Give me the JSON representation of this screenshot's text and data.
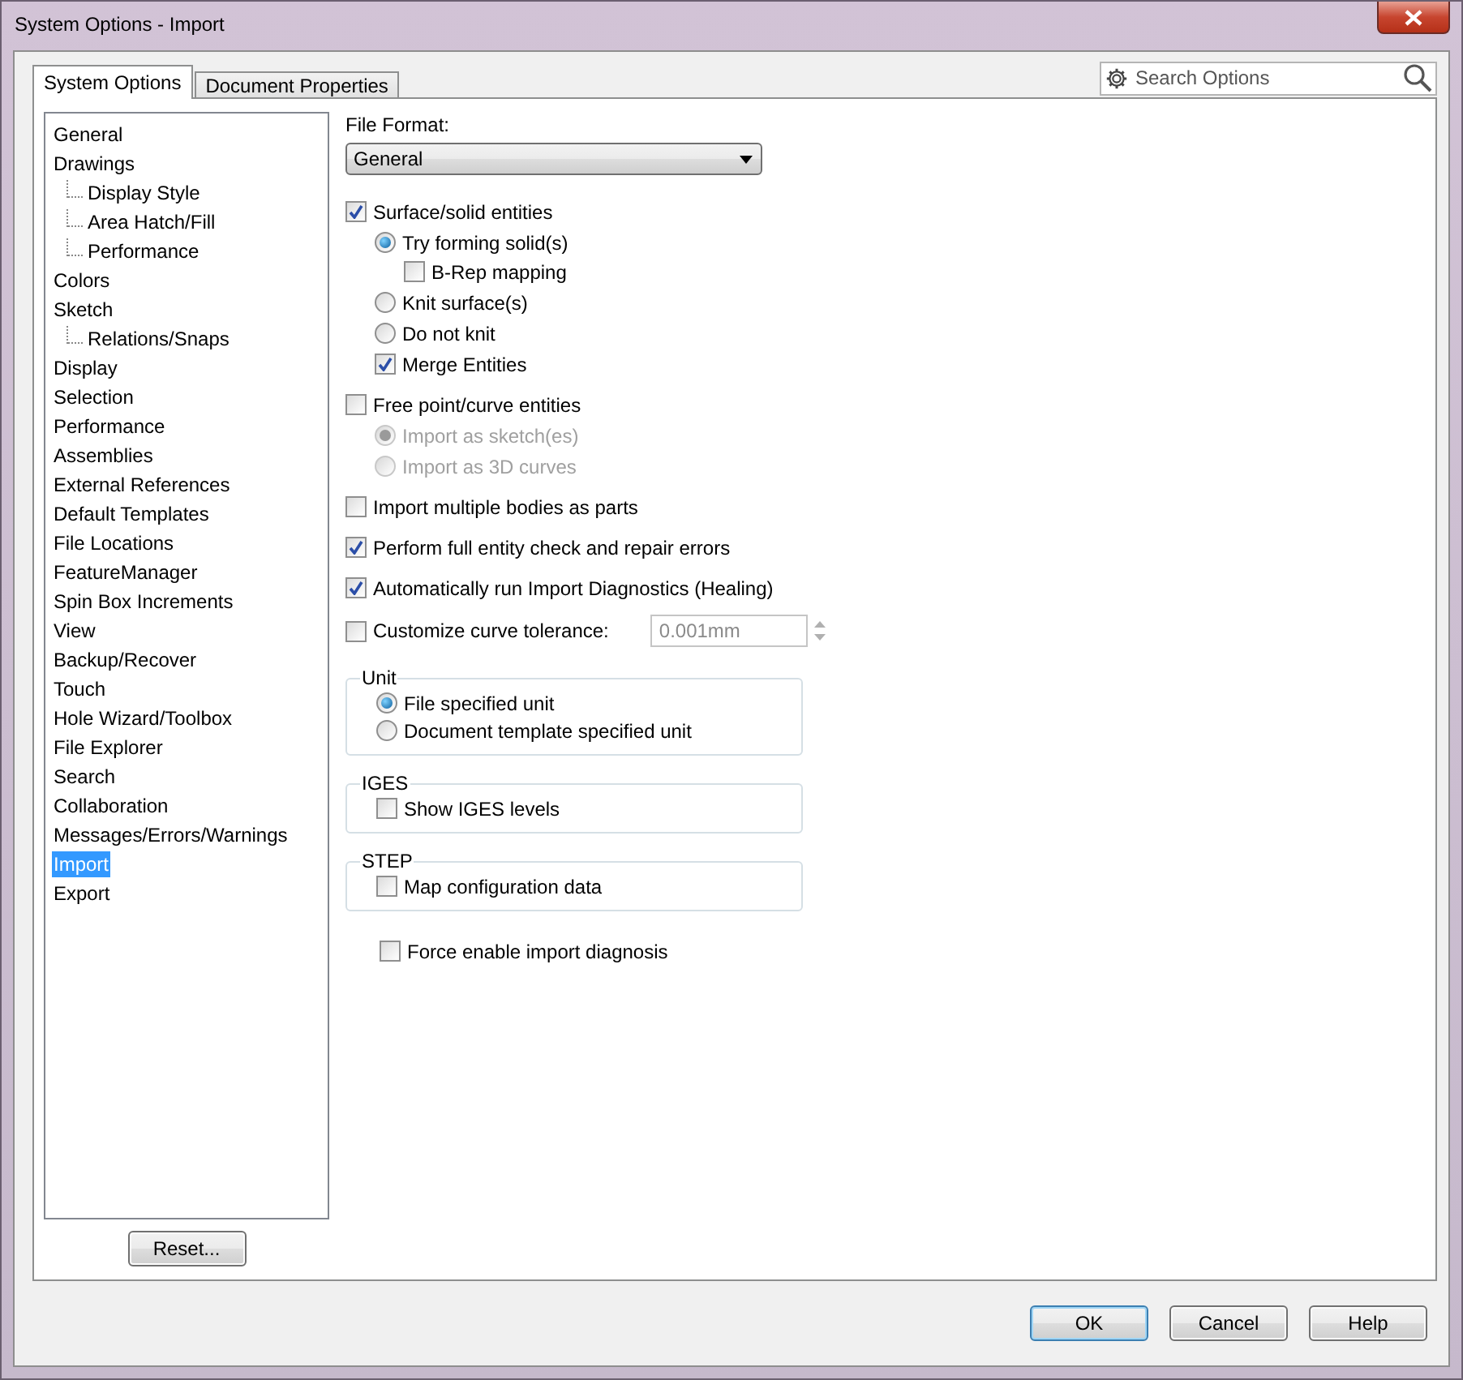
{
  "window": {
    "title": "System Options - Import"
  },
  "tabs": [
    {
      "label": "System Options",
      "selected": true
    },
    {
      "label": "Document Properties",
      "selected": false
    }
  ],
  "search": {
    "placeholder": "Search Options"
  },
  "tree": [
    {
      "label": "General",
      "selected": false
    },
    {
      "label": "Drawings",
      "selected": false,
      "children": [
        {
          "label": "Display Style",
          "selected": false
        },
        {
          "label": "Area Hatch/Fill",
          "selected": false
        },
        {
          "label": "Performance",
          "selected": false
        }
      ]
    },
    {
      "label": "Colors",
      "selected": false
    },
    {
      "label": "Sketch",
      "selected": false,
      "children": [
        {
          "label": "Relations/Snaps",
          "selected": false
        }
      ]
    },
    {
      "label": "Display",
      "selected": false
    },
    {
      "label": "Selection",
      "selected": false
    },
    {
      "label": "Performance",
      "selected": false
    },
    {
      "label": "Assemblies",
      "selected": false
    },
    {
      "label": "External References",
      "selected": false
    },
    {
      "label": "Default Templates",
      "selected": false
    },
    {
      "label": "File Locations",
      "selected": false
    },
    {
      "label": "FeatureManager",
      "selected": false
    },
    {
      "label": "Spin Box Increments",
      "selected": false
    },
    {
      "label": "View",
      "selected": false
    },
    {
      "label": "Backup/Recover",
      "selected": false
    },
    {
      "label": "Touch",
      "selected": false
    },
    {
      "label": "Hole Wizard/Toolbox",
      "selected": false
    },
    {
      "label": "File Explorer",
      "selected": false
    },
    {
      "label": "Search",
      "selected": false
    },
    {
      "label": "Collaboration",
      "selected": false
    },
    {
      "label": "Messages/Errors/Warnings",
      "selected": false
    },
    {
      "label": "Import",
      "selected": true
    },
    {
      "label": "Export",
      "selected": false
    }
  ],
  "reset_button": "Reset...",
  "file_format": {
    "label": "File Format:",
    "value": "General"
  },
  "options": [
    {
      "kind": "checkbox",
      "label": "Surface/solid entities",
      "checked": true,
      "children": [
        {
          "kind": "radio",
          "label": "Try forming solid(s)",
          "selected": true,
          "children": [
            {
              "kind": "checkbox",
              "label": "B-Rep mapping",
              "checked": false
            }
          ]
        },
        {
          "kind": "radio",
          "label": "Knit surface(s)",
          "selected": false
        },
        {
          "kind": "radio",
          "label": "Do not knit",
          "selected": false
        },
        {
          "kind": "checkbox",
          "label": "Merge Entities",
          "checked": true
        }
      ]
    },
    {
      "kind": "checkbox",
      "label": "Free point/curve entities",
      "checked": false,
      "children": [
        {
          "kind": "radio",
          "label": "Import as sketch(es)",
          "selected": true,
          "disabled": true
        },
        {
          "kind": "radio",
          "label": "Import as 3D curves",
          "selected": false,
          "disabled": true
        }
      ]
    },
    {
      "kind": "checkbox",
      "label": "Import multiple bodies as parts",
      "checked": false
    },
    {
      "kind": "checkbox",
      "label": "Perform full entity check and repair errors",
      "checked": true
    },
    {
      "kind": "checkbox",
      "label": "Automatically run Import Diagnostics (Healing)",
      "checked": true
    },
    {
      "kind": "spin",
      "label": "Customize curve tolerance:",
      "checked": false,
      "value": "0.001mm"
    }
  ],
  "groups": [
    {
      "title": "Unit",
      "options": [
        {
          "kind": "radio",
          "label": "File specified unit",
          "selected": true
        },
        {
          "kind": "radio",
          "label": "Document template specified unit",
          "selected": false
        }
      ]
    },
    {
      "title": "IGES",
      "options": [
        {
          "kind": "checkbox",
          "label": "Show IGES levels",
          "checked": false
        }
      ]
    },
    {
      "title": "STEP",
      "options": [
        {
          "kind": "checkbox",
          "label": "Map configuration data",
          "checked": false
        }
      ]
    }
  ],
  "extra_options": [
    {
      "kind": "checkbox",
      "label": "Force enable import diagnosis",
      "checked": false
    }
  ],
  "buttons": [
    {
      "label": "OK",
      "default": true
    },
    {
      "label": "Cancel",
      "default": false
    },
    {
      "label": "Help",
      "default": false
    }
  ]
}
